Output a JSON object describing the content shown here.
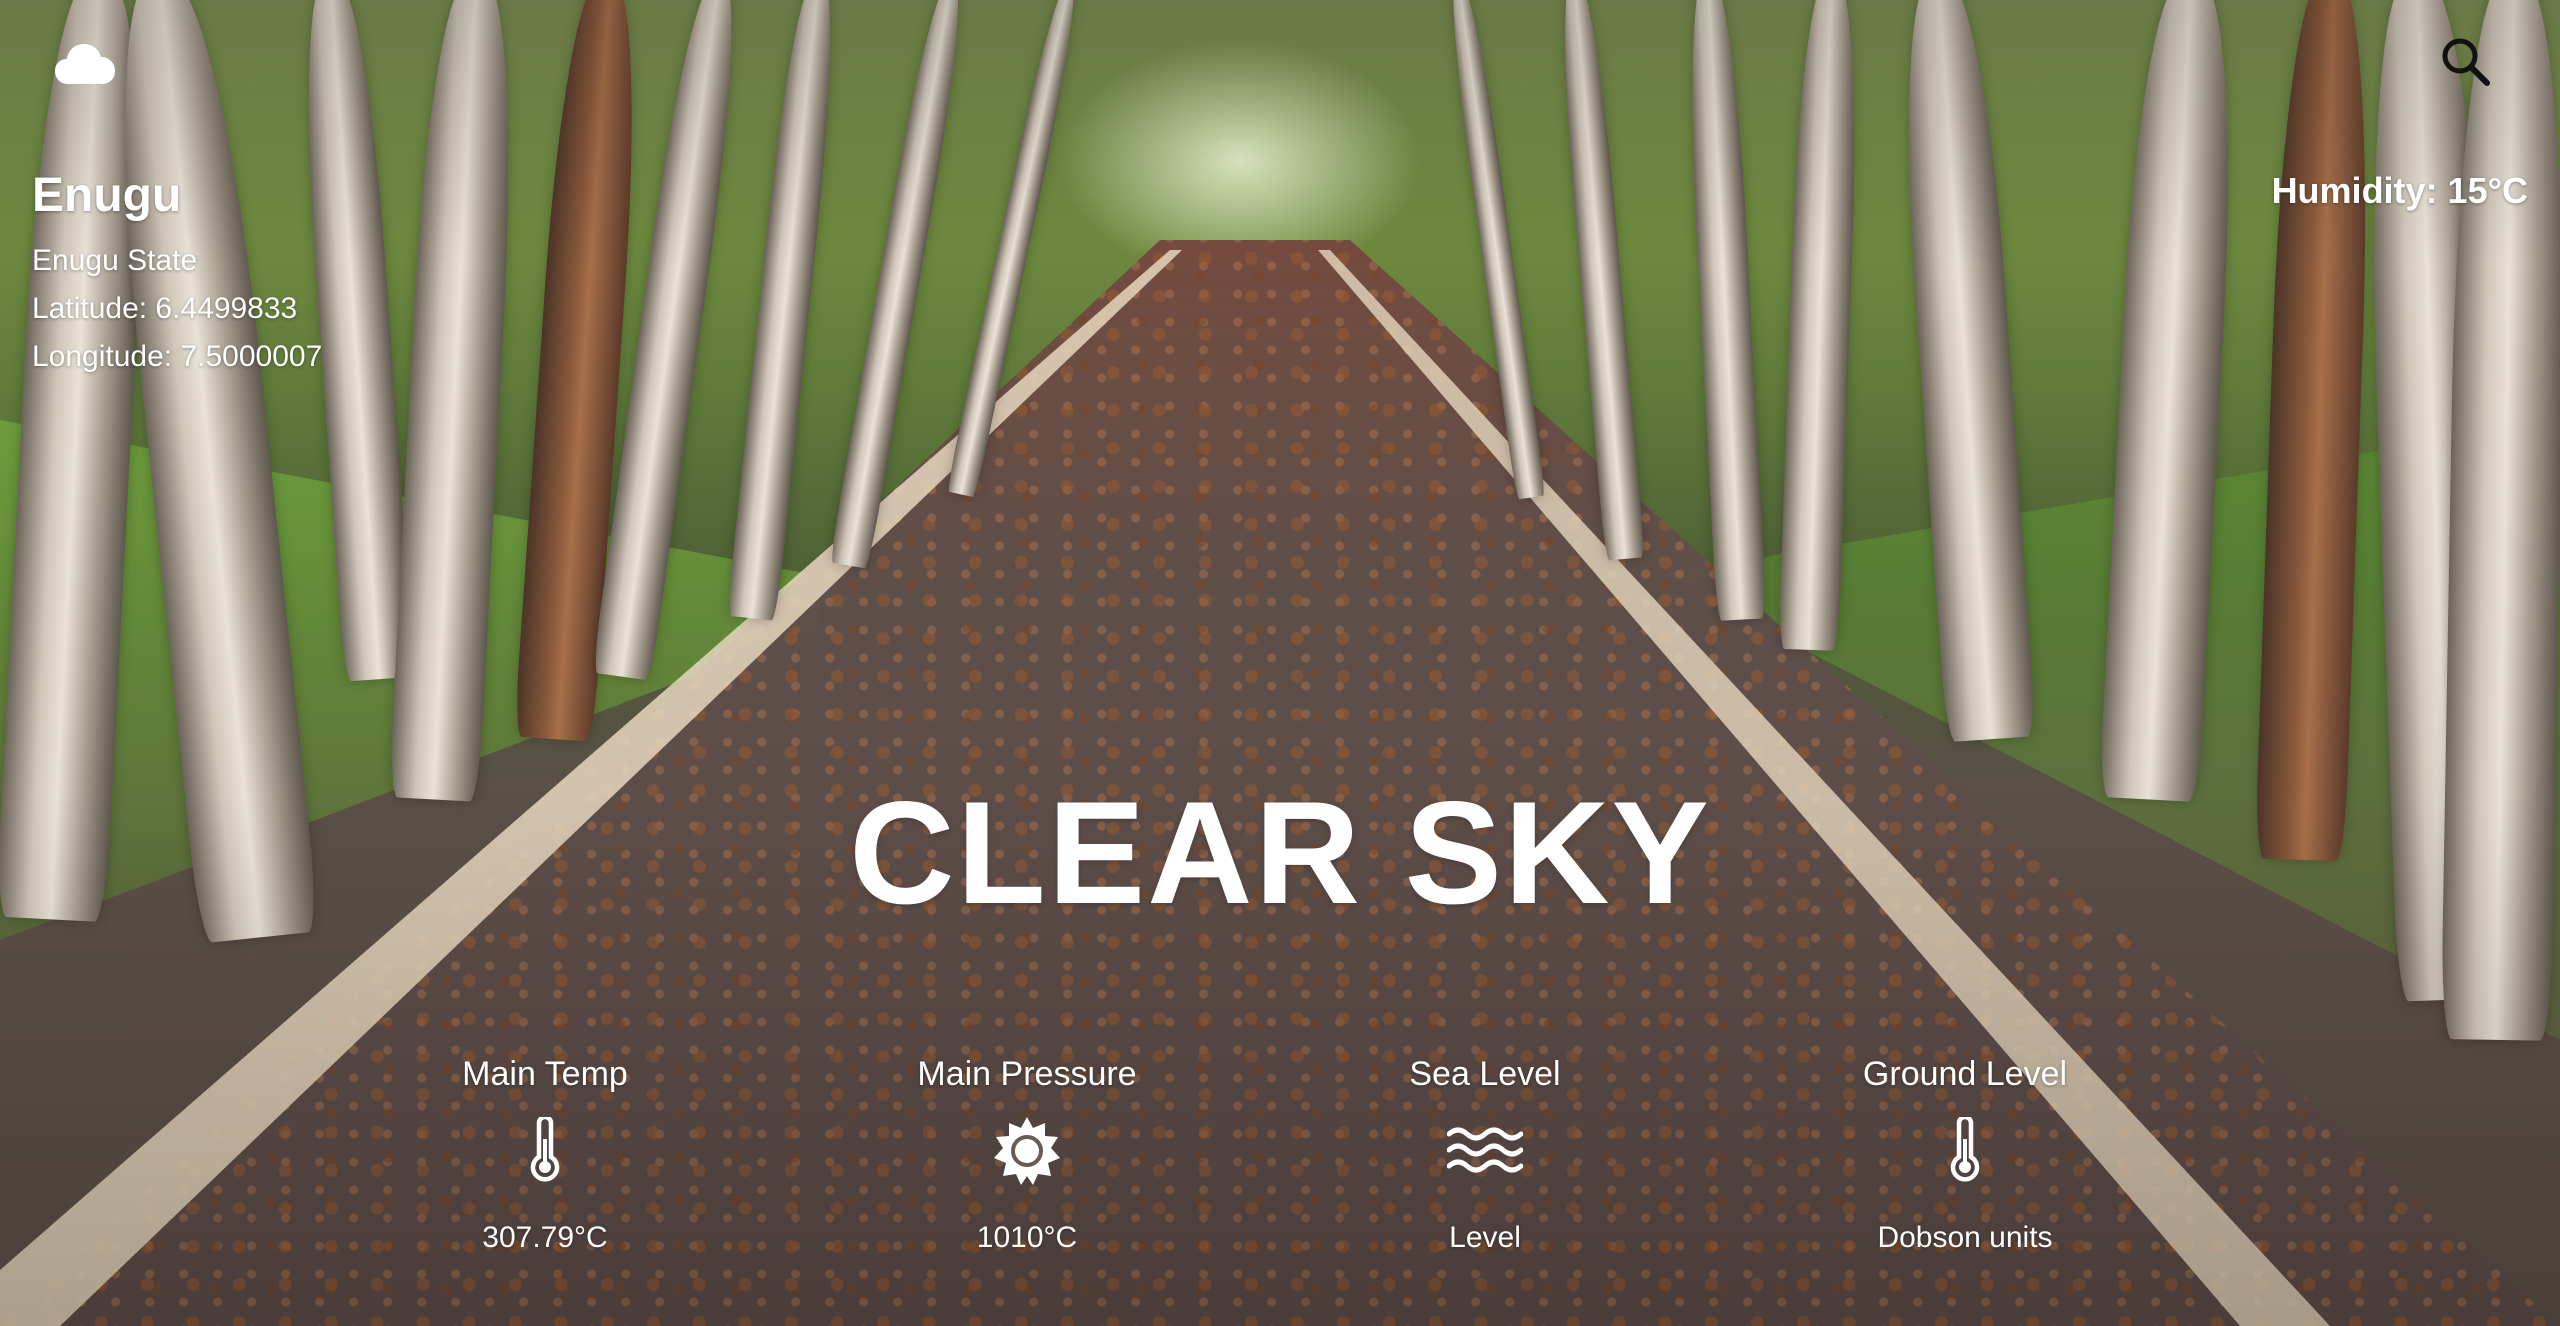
{
  "header": {
    "weather_icon": "cloud-icon",
    "search_icon": "search-icon"
  },
  "location": {
    "city": "Enugu",
    "state": "Enugu State",
    "latitude": "Latitude: 6.4499833",
    "longitude": "Longitude: 7.5000007"
  },
  "humidity": "Humidity: 15°C",
  "condition": "CLEAR SKY",
  "stats": [
    {
      "label": "Main Temp",
      "icon": "thermometer-icon",
      "value": "307.79°C"
    },
    {
      "label": "Main Pressure",
      "icon": "sun-icon",
      "value": "1010°C"
    },
    {
      "label": "Sea Level",
      "icon": "waves-icon",
      "value": "Level"
    },
    {
      "label": "Ground Level",
      "icon": "thermometer-icon",
      "value": "Dobson units"
    }
  ],
  "colors": {
    "text": "#ffffff"
  }
}
